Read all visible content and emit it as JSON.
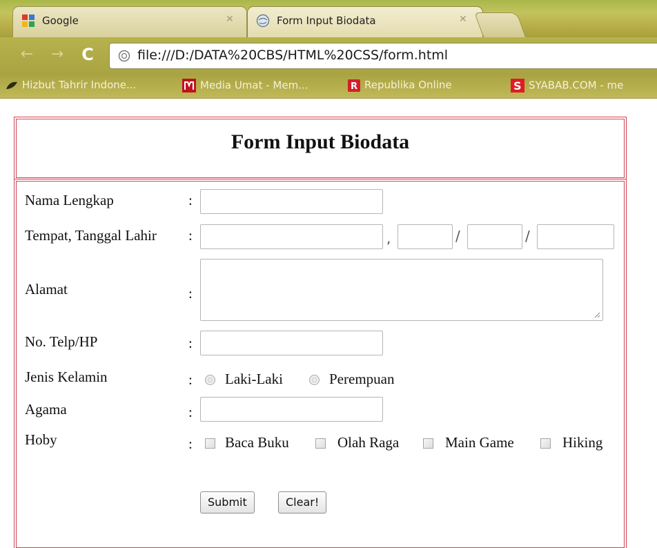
{
  "browser": {
    "tabs": [
      {
        "title": "Google",
        "active": false
      },
      {
        "title": "Form Input Biodata",
        "active": true
      }
    ],
    "address": "file:///D:/DATA%20CBS/HTML%20CSS/form.html",
    "bookmarks": [
      {
        "label": "Hizbut Tahrir Indone...",
        "icon": "leaf-icon"
      },
      {
        "label": "Media Umat - Mem...",
        "icon": "m-logo-icon"
      },
      {
        "label": "Republika Online",
        "icon": "r-logo-icon"
      },
      {
        "label": "SYABAB.COM - me",
        "icon": "s-logo-icon"
      }
    ]
  },
  "form": {
    "heading": "Form Input Biodata",
    "colon": ":",
    "fields": {
      "nama": {
        "label": "Nama Lengkap",
        "value": ""
      },
      "ttl": {
        "label": "Tempat, Tanggal Lahir",
        "value": "",
        "sep_comma": ",",
        "sep_slash": "/"
      },
      "alamat": {
        "label": "Alamat",
        "value": ""
      },
      "telp": {
        "label": "No. Telp/HP",
        "value": ""
      },
      "kelamin": {
        "label": "Jenis Kelamin",
        "options": [
          "Laki-Laki",
          "Perempuan"
        ]
      },
      "agama": {
        "label": "Agama",
        "value": ""
      },
      "hoby": {
        "label": "Hoby",
        "options": [
          "Baca Buku",
          "Olah Raga",
          "Main Game",
          "Hiking"
        ]
      }
    },
    "buttons": {
      "submit": "Submit",
      "clear": "Clear!"
    }
  },
  "colors": {
    "border": "#d04050",
    "chrome": "#b6b24c"
  }
}
